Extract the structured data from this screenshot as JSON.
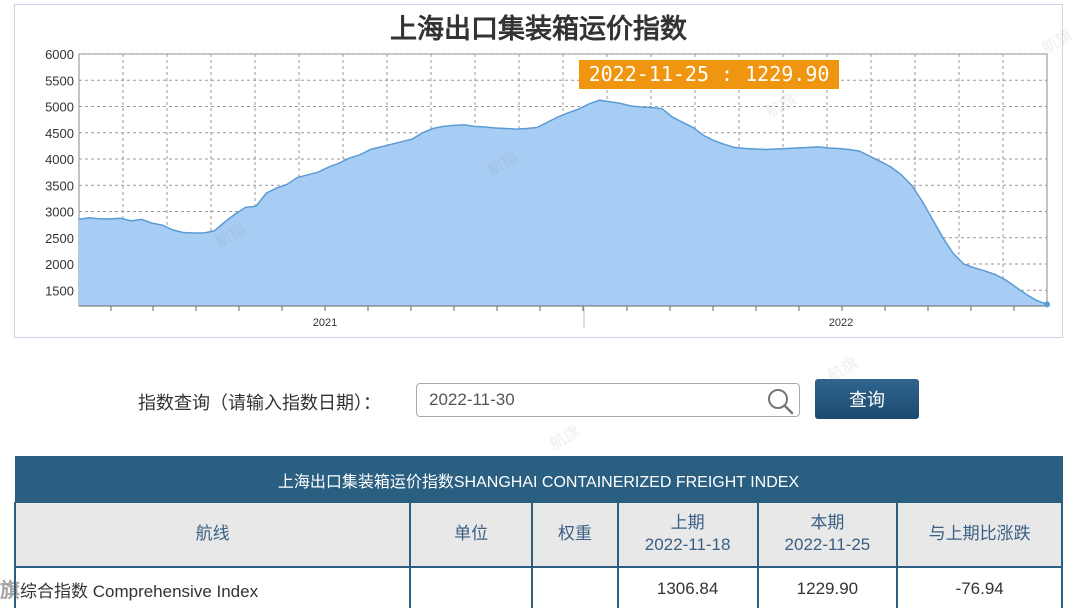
{
  "chart": {
    "title": "上海出口集装箱运价指数",
    "tooltip": "2022-11-25 : 1229.90",
    "area_color": "#a8cdf4",
    "line_color": "#5a9bd5",
    "tooltip_color": "#f0950f"
  },
  "chart_data": {
    "type": "area",
    "title": "上海出口集装箱运价指数",
    "xlabel": "",
    "ylabel": "",
    "ylim": [
      1200,
      6000
    ],
    "yticks": [
      6000,
      5500,
      5000,
      4500,
      4000,
      3500,
      3000,
      2500,
      2000,
      1500
    ],
    "x_tick_labels": [
      "2021",
      "2022"
    ],
    "grid": true,
    "series": [
      {
        "values": [
          2850,
          2880,
          2860,
          2860,
          2870,
          2820,
          2850,
          2780,
          2740,
          2650,
          2600,
          2590,
          2590,
          2630,
          2800,
          2950,
          3080,
          3100,
          3350,
          3450,
          3520,
          3650,
          3700,
          3750,
          3850,
          3920,
          4020,
          4080,
          4180,
          4230,
          4280,
          4330,
          4380,
          4500,
          4580,
          4620,
          4640,
          4650,
          4620,
          4610,
          4590,
          4580,
          4570,
          4580,
          4600,
          4700,
          4800,
          4880,
          4950,
          5050,
          5120,
          5090,
          5060,
          5010,
          4990,
          4980,
          4960,
          4800,
          4700,
          4600,
          4450,
          4350,
          4280,
          4220,
          4200,
          4190,
          4180,
          4190,
          4200,
          4210,
          4220,
          4230,
          4210,
          4200,
          4180,
          4150,
          4050,
          3950,
          3850,
          3700,
          3500,
          3200,
          2850,
          2500,
          2200,
          2000,
          1930,
          1870,
          1800,
          1700,
          1560,
          1420,
          1306.84,
          1229.9
        ]
      }
    ],
    "highlight": {
      "date": "2022-11-25",
      "value": 1229.9
    }
  },
  "query": {
    "label": "指数查询（请输入指数日期）：",
    "value": "2022-11-30",
    "button_label": "查询"
  },
  "table": {
    "caption": "上海出口集装箱运价指数SHANGHAI CONTAINERIZED FREIGHT INDEX",
    "headers": {
      "route": "航线",
      "unit": "单位",
      "weight": "权重",
      "prev_label": "上期",
      "prev_date": "2022-11-18",
      "curr_label": "本期",
      "curr_date": "2022-11-25",
      "change": "与上期比涨跌"
    },
    "rows": [
      {
        "route": "综合指数 Comprehensive Index",
        "unit": "",
        "weight": "",
        "prev": "1306.84",
        "curr": "1229.90",
        "change": "-76.94"
      }
    ]
  },
  "watermark": "航旗",
  "corner_logo": "旗"
}
